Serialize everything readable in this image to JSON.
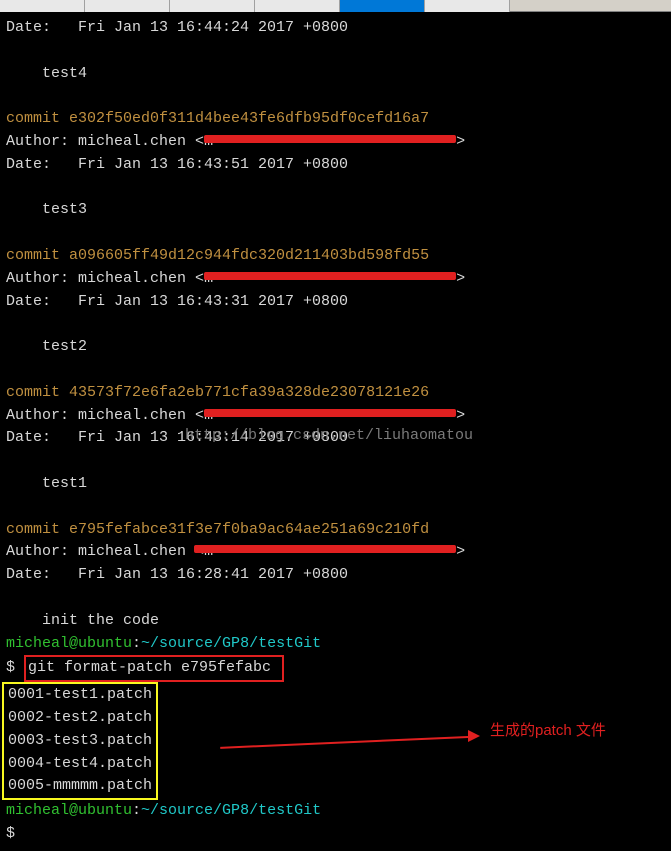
{
  "tabs": [
    "",
    "",
    "",
    "",
    "",
    ""
  ],
  "activeTab": 4,
  "watermark": "http://blog.csdn.net/liuhaomatou",
  "annotation": "生成的patch 文件",
  "prompt_user": "micheal@ubuntu",
  "prompt_path": "~/source/GP8/testGit",
  "command": "git format-patch e795fefabc",
  "patches": [
    "0001-test1.patch",
    "0002-test2.patch",
    "0003-test3.patch",
    "0004-test4.patch",
    "0005-mmmmm.patch"
  ],
  "commits": [
    {
      "date": "Fri Jan 13 16:44:24 2017 +0800",
      "msg": "test4"
    },
    {
      "hash": "e302f50ed0f311d4bee43fe6dfb95df0cefd16a7",
      "author": "micheal.chen",
      "email_mask": "m                           ",
      "date": "Fri Jan 13 16:43:51 2017 +0800",
      "msg": "test3"
    },
    {
      "hash": "a096605ff49d12c944fdc320d211403bd598fd55",
      "author": "micheal.chen",
      "email_mask": "m                           ",
      "date": "Fri Jan 13 16:43:31 2017 +0800",
      "msg": "test2"
    },
    {
      "hash": "43573f72e6fa2eb771cfa39a328de23078121e26",
      "author": "micheal.chen",
      "email_mask": "m                           ",
      "date": "Fri Jan 13 16:43:14 2017 +0800",
      "msg": "test1"
    },
    {
      "hash": "e795fefabce31f3e7f0ba9ac64ae251a69c210fd",
      "author": "micheal.chen",
      "email_mask": "m                           ",
      "date": "Fri Jan 13 16:28:41 2017 +0800",
      "msg": "init the code"
    }
  ],
  "labels": {
    "author": "Author: ",
    "date": "Date:   ",
    "commit": "commit "
  }
}
